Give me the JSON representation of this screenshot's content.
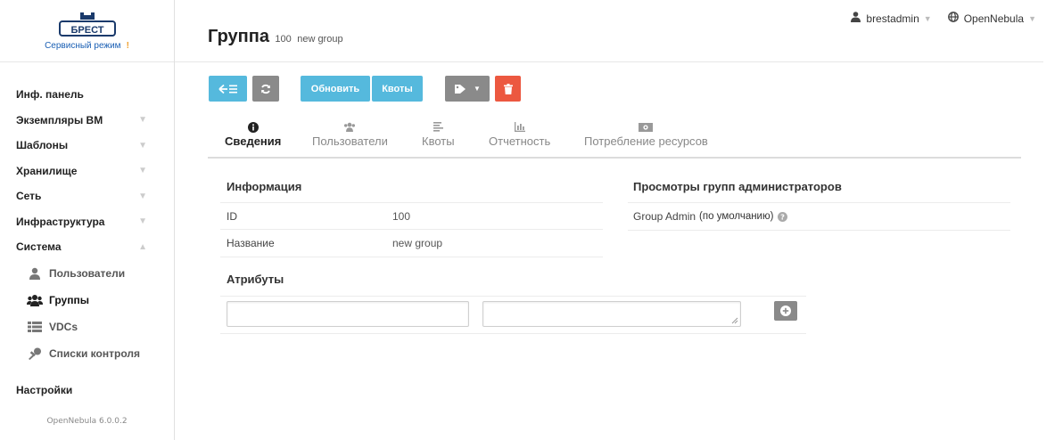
{
  "logo": {
    "subtitle": "Сервисный режим",
    "warn_glyph": "!",
    "brand_text": "БРЕСТ"
  },
  "sidebar": {
    "items": [
      {
        "label": "Инф. панель",
        "chevron": ""
      },
      {
        "label": "Экземпляры ВМ",
        "chevron": "▼"
      },
      {
        "label": "Шаблоны",
        "chevron": "▼"
      },
      {
        "label": "Хранилище",
        "chevron": "▼"
      },
      {
        "label": "Сеть",
        "chevron": "▼"
      },
      {
        "label": "Инфраструктура",
        "chevron": "▼"
      },
      {
        "label": "Система",
        "chevron": "▲"
      }
    ],
    "sub_items": [
      {
        "label": "Пользователи",
        "icon": "user-icon"
      },
      {
        "label": "Группы",
        "icon": "users-icon"
      },
      {
        "label": "VDCs",
        "icon": "list-icon"
      },
      {
        "label": "Списки контроля",
        "icon": "key-icon"
      }
    ],
    "settings_label": "Настройки",
    "version": "OpenNebula 6.0.0.2"
  },
  "header": {
    "title": "Группа",
    "id": "100",
    "name": "new group",
    "user": "brestadmin",
    "zone": "OpenNebula"
  },
  "toolbar": {
    "update_label": "Обновить",
    "quotas_label": "Квоты",
    "colors": {
      "blue": "#55b9dd",
      "gray": "#8a8a8a",
      "red": "#ec5840"
    }
  },
  "tabs": [
    {
      "label": "Сведения",
      "icon": "info-icon",
      "active": true
    },
    {
      "label": "Пользователи",
      "icon": "users-icon",
      "active": false
    },
    {
      "label": "Квоты",
      "icon": "align-icon",
      "active": false
    },
    {
      "label": "Отчетность",
      "icon": "bar-chart-icon",
      "active": false
    },
    {
      "label": "Потребление ресурсов",
      "icon": "money-icon",
      "active": false
    }
  ],
  "info": {
    "title": "Информация",
    "rows": [
      {
        "key": "ID",
        "value": "100"
      },
      {
        "key": "Название",
        "value": "new group"
      }
    ]
  },
  "admin_views": {
    "title": "Просмотры групп администраторов",
    "item": "Group Admin",
    "default_note": "(по умолчанию)"
  },
  "attributes": {
    "title": "Атрибуты",
    "key_value": "",
    "value_value": ""
  }
}
